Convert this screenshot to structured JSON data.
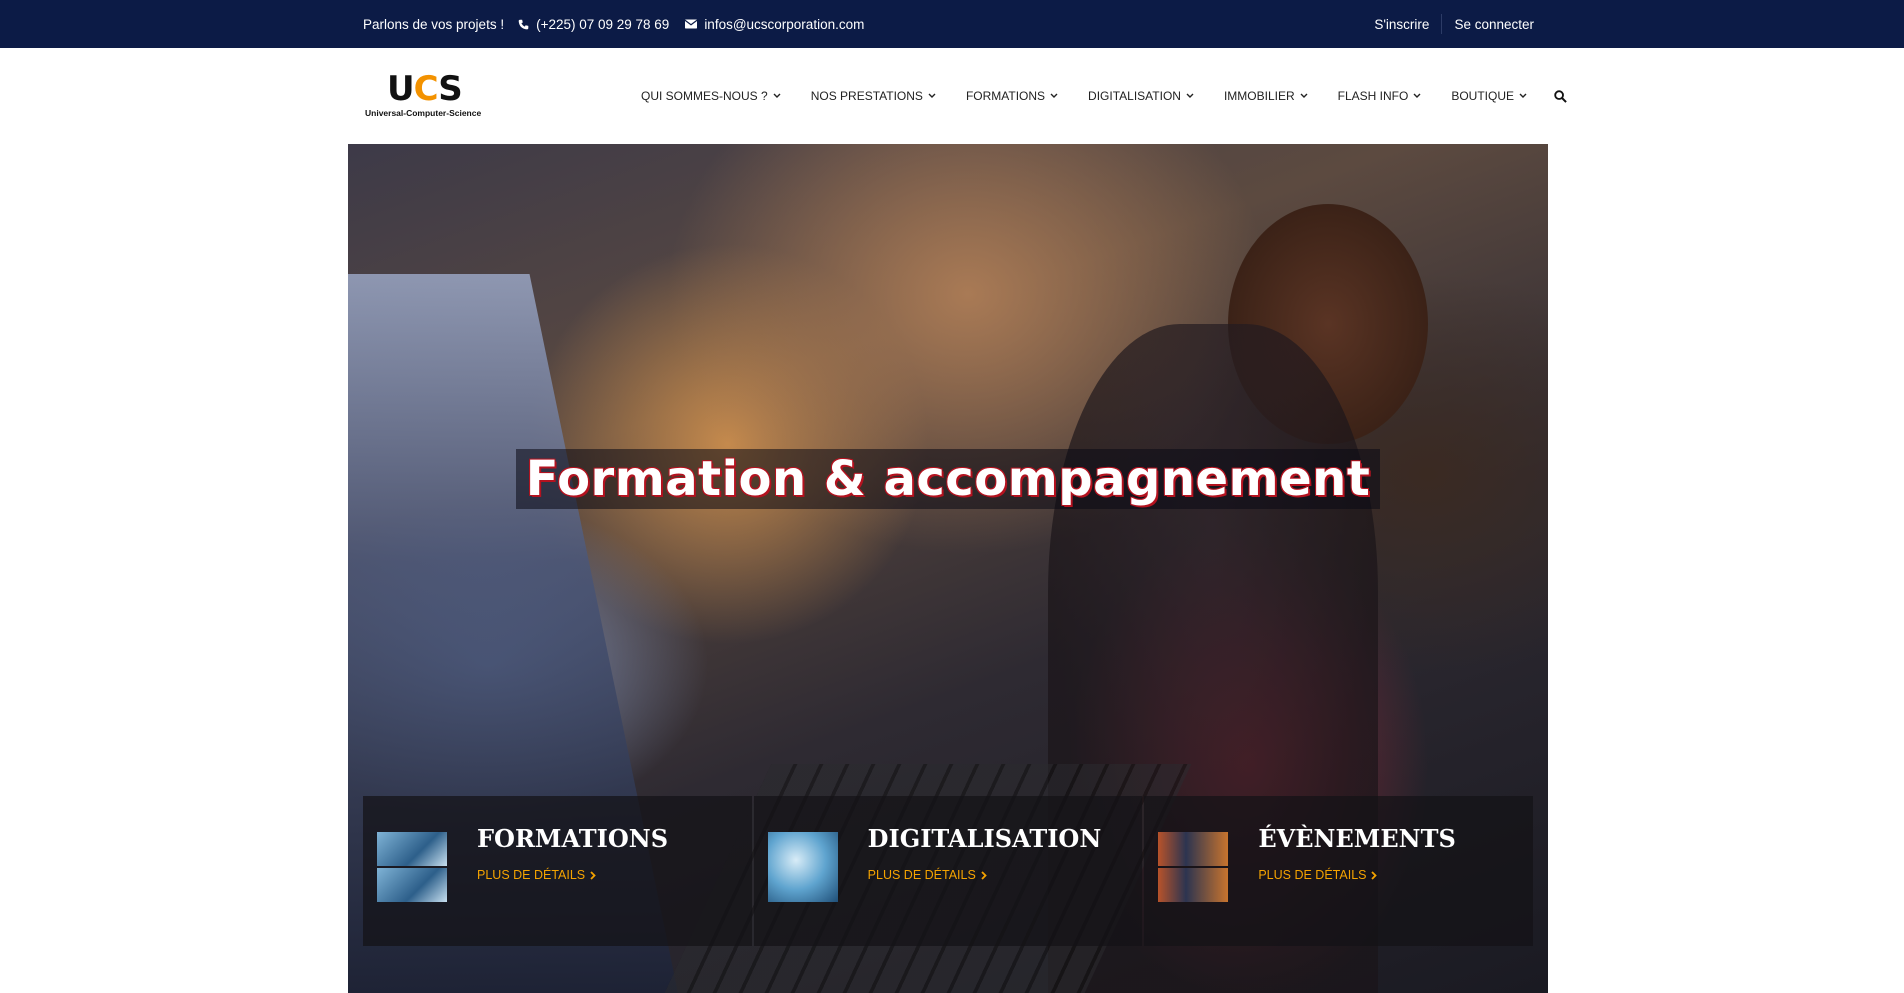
{
  "topbar": {
    "tagline": "Parlons de vos projets !",
    "phone": "(+225) 07 09 29 78 69",
    "email": "infos@ucscorporation.com",
    "signup": "S'inscrire",
    "login": "Se connecter"
  },
  "logo": {
    "mark_u": "U",
    "mark_c": "C",
    "mark_s": "S",
    "subtitle": "Universal-Computer-Science"
  },
  "nav": {
    "items": [
      {
        "label": "QUI SOMMES-NOUS ?"
      },
      {
        "label": "NOS PRESTATIONS"
      },
      {
        "label": "FORMATIONS"
      },
      {
        "label": "DIGITALISATION"
      },
      {
        "label": "IMMOBILIER"
      },
      {
        "label": "FLASH INFO"
      },
      {
        "label": "BOUTIQUE"
      }
    ]
  },
  "hero": {
    "headline": "Formation & accompagnement",
    "cards": [
      {
        "title": "FORMATIONS",
        "link": "PLUS DE DÉTAILS"
      },
      {
        "title": "DIGITALISATION",
        "link": "PLUS DE DÉTAILS"
      },
      {
        "title": "ÉVÈNEMENTS",
        "link": "PLUS DE DÉTAILS"
      }
    ]
  },
  "colors": {
    "topbar_bg": "#0c1b46",
    "accent": "#f5a300",
    "logo_accent": "#f39200"
  }
}
